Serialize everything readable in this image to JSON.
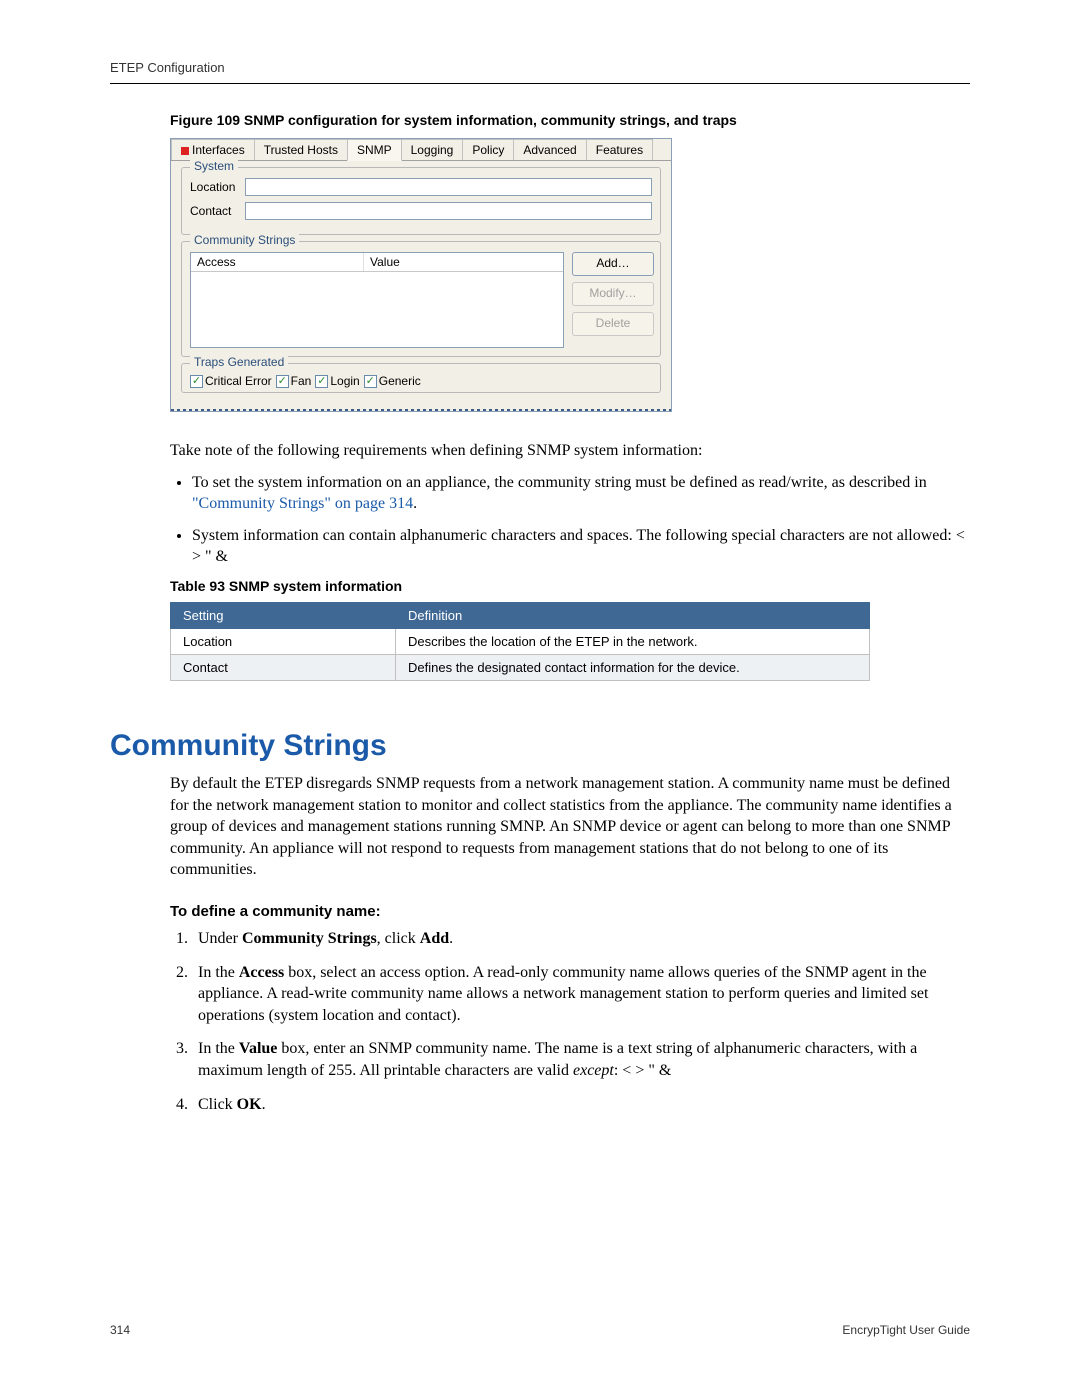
{
  "header": {
    "title": "ETEP Configuration"
  },
  "figure": {
    "caption": "Figure 109   SNMP configuration for system information, community strings, and traps",
    "tabs": [
      "Interfaces",
      "Trusted Hosts",
      "SNMP",
      "Logging",
      "Policy",
      "Advanced",
      "Features"
    ],
    "active_tab_index": 2,
    "system": {
      "legend": "System",
      "location_label": "Location",
      "location_value": "",
      "contact_label": "Contact",
      "contact_value": ""
    },
    "community_strings": {
      "legend": "Community Strings",
      "col_access": "Access",
      "col_value": "Value",
      "btn_add": "Add…",
      "btn_modify": "Modify…",
      "btn_delete": "Delete"
    },
    "traps": {
      "legend": "Traps Generated",
      "options": [
        "Critical Error",
        "Fan",
        "Login",
        "Generic"
      ]
    }
  },
  "intro": "Take note of the following requirements when defining SNMP system information:",
  "bullets": {
    "b1_pre": "To set the system information on an appliance, the community string must be defined as read/write, as described in ",
    "b1_link": "\"Community Strings\" on page 314",
    "b1_post": ".",
    "b2": "System information can contain alphanumeric characters and spaces. The following special characters are not allowed: < > \" &"
  },
  "table": {
    "caption": "Table 93      SNMP system information",
    "head_setting": "Setting",
    "head_definition": "Definition",
    "rows": [
      {
        "setting": "Location",
        "definition": "Describes the location of the ETEP in the network."
      },
      {
        "setting": "Contact",
        "definition": "Defines the designated contact information for the device."
      }
    ]
  },
  "section": {
    "title": "Community Strings",
    "para": "By default the ETEP disregards SNMP requests from a network management station. A community name must be defined for the network management station to monitor and collect statistics from the appliance. The community name identifies a group of devices and management stations running SMNP. An SNMP device or agent can belong to more than one SNMP community. An appliance will not respond to requests from management stations that do not belong to one of its communities.",
    "sub": "To define a community name:",
    "steps": {
      "s1_pre": "Under ",
      "s1_b1": "Community Strings",
      "s1_mid": ", click ",
      "s1_b2": "Add",
      "s1_post": ".",
      "s2_pre": "In the ",
      "s2_b1": "Access",
      "s2_post": " box, select an access option. A read-only community name allows queries of the SNMP agent in the appliance. A read-write community name allows a network management station to perform queries and limited set operations (system location and contact).",
      "s3_pre": "In the ",
      "s3_b1": "Value",
      "s3_mid": " box, enter an SNMP community name. The name is a text string of alphanumeric characters, with a maximum length of 255. All printable characters are valid ",
      "s3_i": "except",
      "s3_post": ": < > \" &",
      "s4_pre": "Click ",
      "s4_b1": "OK",
      "s4_post": "."
    }
  },
  "footer": {
    "page": "314",
    "guide": "EncrypTight User Guide"
  }
}
